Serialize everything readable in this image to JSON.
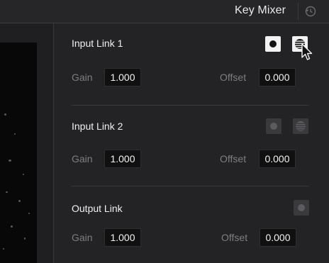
{
  "header": {
    "title": "Key Mixer"
  },
  "sections": [
    {
      "title": "Input Link 1",
      "gain_label": "Gain",
      "gain_value": "1.000",
      "offset_label": "Offset",
      "offset_value": "0.000"
    },
    {
      "title": "Input Link 2",
      "gain_label": "Gain",
      "gain_value": "1.000",
      "offset_label": "Offset",
      "offset_value": "0.000"
    },
    {
      "title": "Output Link",
      "gain_label": "Gain",
      "gain_value": "1.000",
      "offset_label": "Offset",
      "offset_value": "0.000"
    }
  ],
  "icons": {
    "reset": "reset-icon",
    "key_dot": "key-dot-icon",
    "matte": "matte-stripes-icon",
    "cursor": "mouse-pointer-icon"
  },
  "colors": {
    "panel_bg": "#232325",
    "field_bg": "#101011",
    "label": "#7e7e82",
    "active_button": "#f2f2f2",
    "inactive_button": "#3a3a3d"
  }
}
